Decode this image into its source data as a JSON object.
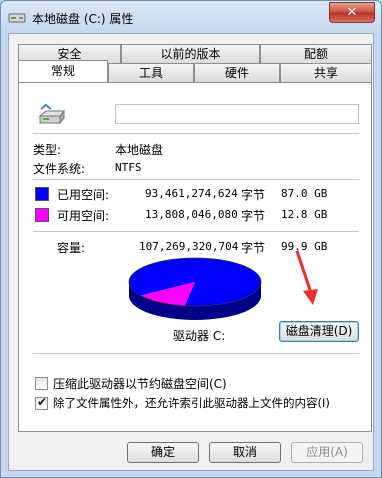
{
  "window": {
    "title": "本地磁盘 (C:) 属性",
    "close_glyph": "✕"
  },
  "tabs": {
    "row1": [
      "安全",
      "以前的版本",
      "配额"
    ],
    "row2": [
      "常规",
      "工具",
      "硬件",
      "共享"
    ],
    "active": "常规"
  },
  "general": {
    "drive_name_value": "",
    "type_label": "类型:",
    "type_value": "本地磁盘",
    "fs_label": "文件系统:",
    "fs_value": "NTFS",
    "used": {
      "label": "已用空间:",
      "bytes": "93,461,274,624",
      "unit": "字节",
      "size": "87.0 GB",
      "color": "#0000ff"
    },
    "free": {
      "label": "可用空间:",
      "bytes": "13,808,046,080",
      "unit": "字节",
      "size": "12.8 GB",
      "color": "#ff00ff"
    },
    "capacity": {
      "label": "容量:",
      "bytes": "107,269,320,704",
      "unit": "字节",
      "size": "99.9 GB"
    },
    "drive_label": "驱动器 C:",
    "cleanup_button": "磁盘清理(D)",
    "compress_checkbox": {
      "label": "压缩此驱动器以节约磁盘空间(C)",
      "checked": false
    },
    "index_checkbox": {
      "label": "除了文件属性外，还允许索引此驱动器上文件的内容(I)",
      "checked": true
    },
    "used_fraction": 0.871
  },
  "footer": {
    "ok": "确定",
    "cancel": "取消",
    "apply": "应用(A)"
  },
  "colors": {
    "annotation_arrow": "#e8312a"
  }
}
